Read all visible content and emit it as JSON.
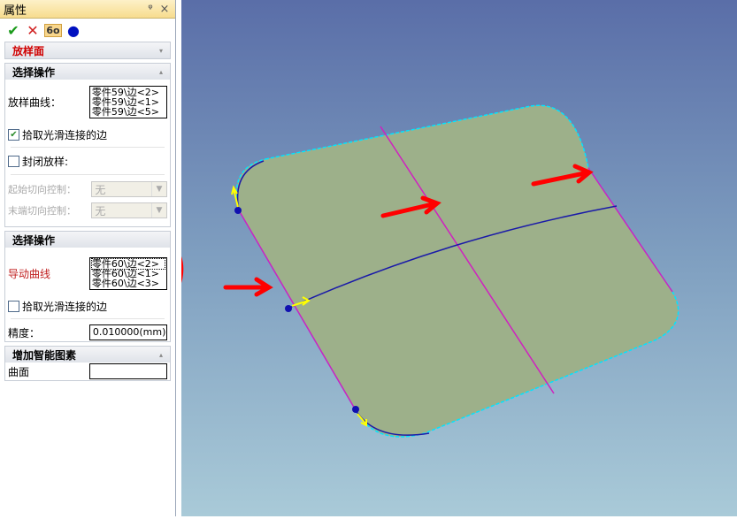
{
  "panel": {
    "title": "属性",
    "pin": "ᵠ",
    "close": "×",
    "toolbar": {
      "ok": "✔",
      "cancel": "✕",
      "preview": "6o",
      "color": "●"
    },
    "feature": {
      "title": "放样面",
      "arrow": "▾"
    },
    "section1": {
      "title": "选择操作",
      "arrow": "▴",
      "curves_label": "放样曲线：",
      "curves": [
        "零件59\\边<2>",
        "零件59\\边<1>",
        "零件59\\边<5>"
      ],
      "smooth_label": "拾取光滑连接的边",
      "smooth_checked": true,
      "closed_label": "封闭放样:",
      "closed_checked": false,
      "start_label": "起始切向控制：",
      "start_value": "无",
      "end_label": "末端切向控制：",
      "end_value": "无"
    },
    "section2": {
      "title": "选择操作",
      "guide_label": "导动曲线",
      "guides": [
        "零件60\\边<2>",
        "零件60\\边<1>",
        "零件60\\边<3>"
      ],
      "smooth_label": "拾取光滑连接的边",
      "smooth_checked": false,
      "precision_label": "精度：",
      "precision_value": "0.010000(mm)"
    },
    "section3": {
      "title": "增加智能图素",
      "arrow": "▴",
      "surface_label": "曲面",
      "surface_value": ""
    }
  },
  "colors": {
    "surface": "#9db08a",
    "guide": "#1a1aa8",
    "edge": "#d020c0",
    "annotation": "#ff0000",
    "highlight": "#00e5ff"
  }
}
